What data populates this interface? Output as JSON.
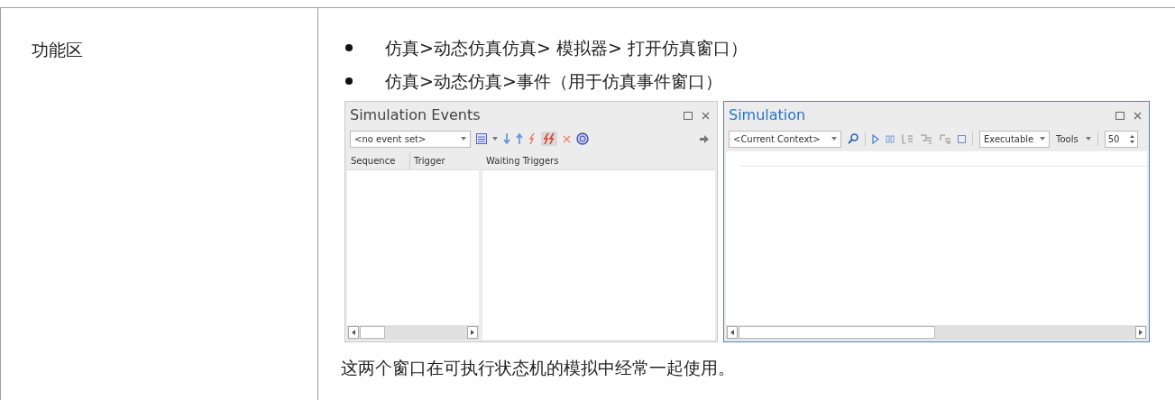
{
  "feature_cell": {
    "label": "功能区"
  },
  "bullets": [
    "仿真>动态仿真仿真> 模拟器> 打开仿真窗口）",
    "仿真>动态仿真>事件（用于仿真事件窗口）"
  ],
  "events_window": {
    "title": "Simulation Events",
    "event_set": "<no event set>",
    "columns": [
      "Sequence",
      "Trigger"
    ],
    "waiting_column": "Waiting Triggers"
  },
  "simulation_window": {
    "title": "Simulation",
    "context": "<Current Context>",
    "mode": "Executable",
    "tools": "Tools",
    "speed": "50"
  },
  "note": "这两个窗口在可执行状态机的模拟中经常一起使用。"
}
